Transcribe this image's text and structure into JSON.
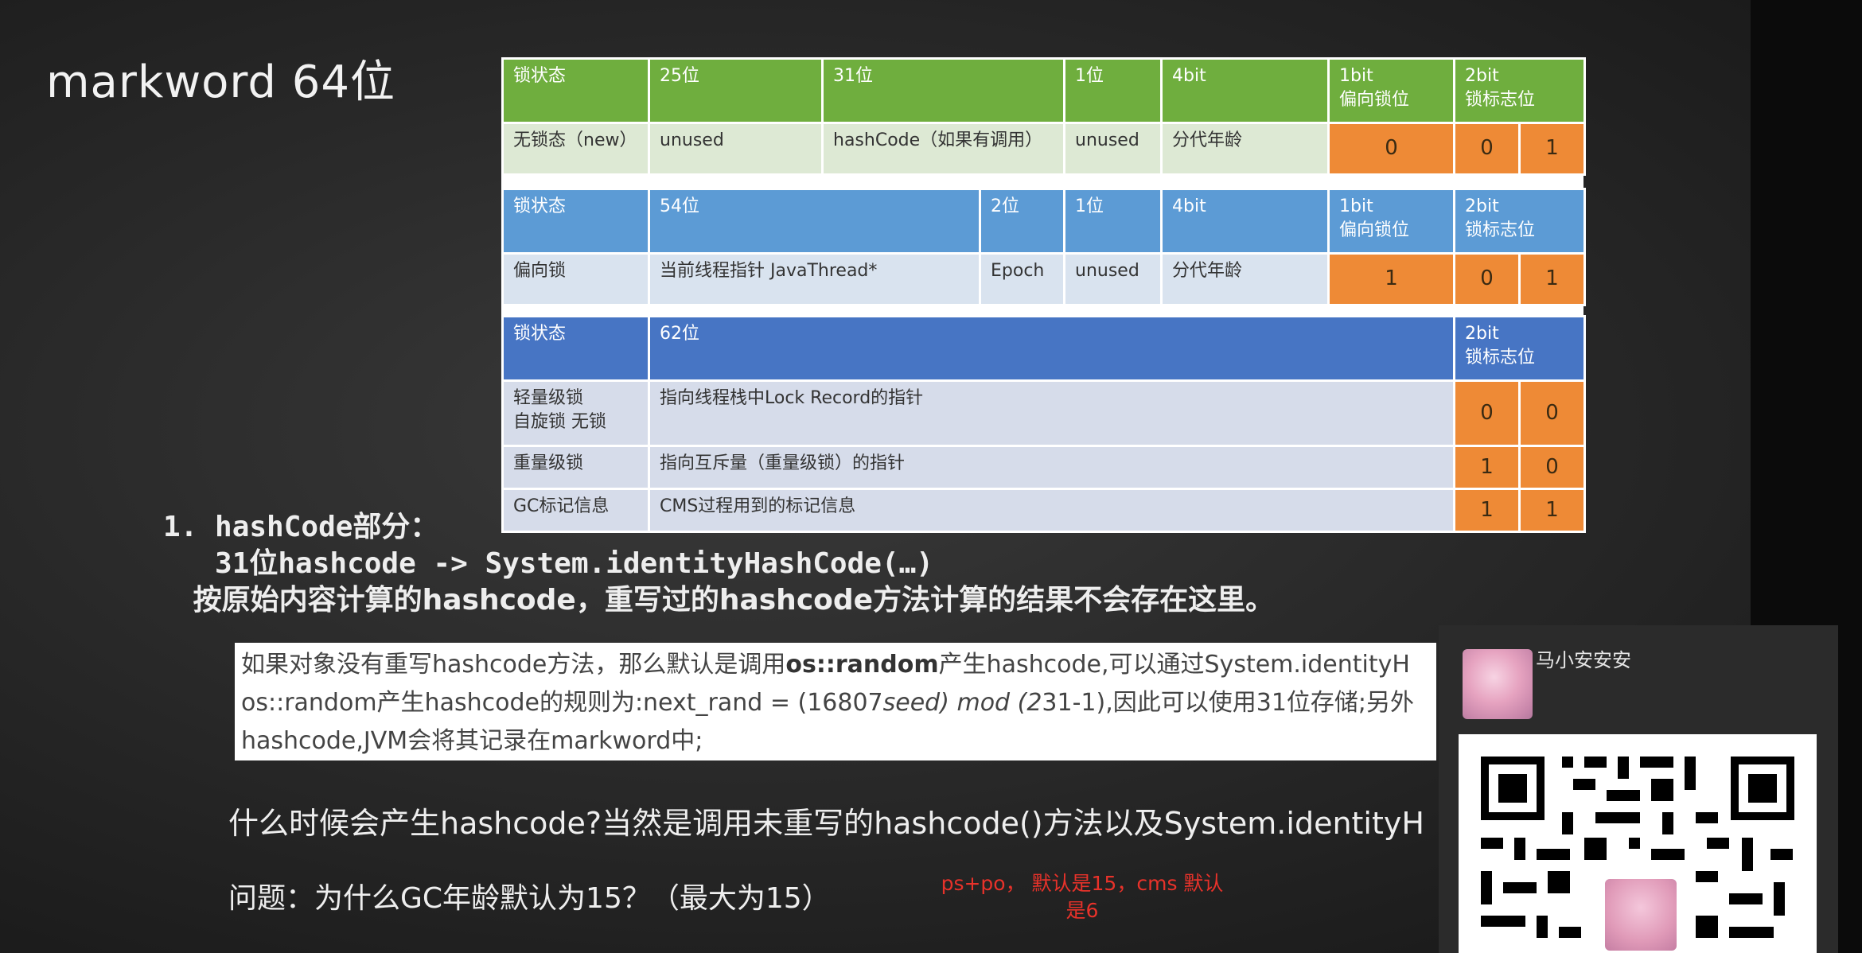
{
  "slide": {
    "title": "markword 64位"
  },
  "table": {
    "green": {
      "header": [
        "锁状态",
        "25位",
        "31位",
        "1位",
        "4bit",
        "1bit\n偏向锁位",
        "2bit\n锁标志位"
      ],
      "row": {
        "state": "无锁态（new）",
        "c25": "unused",
        "c31": "hashCode（如果有调用）",
        "c1": "unused",
        "age": "分代年龄",
        "biased": "0",
        "flag1": "0",
        "flag2": "1"
      }
    },
    "blue": {
      "header": [
        "锁状态",
        "54位",
        "2位",
        "1位",
        "4bit",
        "1bit\n偏向锁位",
        "2bit\n锁标志位"
      ],
      "row": {
        "state": "偏向锁",
        "c54": "当前线程指针 JavaThread*",
        "epoch": "Epoch",
        "c1": "unused",
        "age": "分代年龄",
        "biased": "1",
        "flag1": "0",
        "flag2": "1"
      }
    },
    "dark": {
      "header": [
        "锁状态",
        "62位",
        "2bit\n锁标志位"
      ],
      "rows": [
        {
          "state": "轻量级锁\n自旋锁 无锁",
          "content": "指向线程栈中Lock Record的指针",
          "flag1": "0",
          "flag2": "0"
        },
        {
          "state": "重量级锁",
          "content": "指向互斥量（重量级锁）的指针",
          "flag1": "1",
          "flag2": "0"
        },
        {
          "state": "GC标记信息",
          "content": "CMS过程用到的标记信息",
          "flag1": "1",
          "flag2": "1"
        }
      ]
    }
  },
  "section": {
    "line1": "1. hashCode部分：",
    "line2": "   31位hashcode -> System.identityHashCode(…)",
    "line3": "   按原始内容计算的hashcode，重写过的hashcode方法计算的结果不会存在这里。"
  },
  "note": {
    "line1_a": "如果对象没有重写hashcode方法，那么默认是调用",
    "line1_b": "os::random",
    "line1_c": "产生hashcode,可以通过System.identityH",
    "line2_a": "os::random产生hashcode的规则为:next_rand = (16807",
    "line2_b": "seed) mod (2",
    "line2_c": "31-1),因此可以使用31位存储;另外",
    "line3": "hashcode,JVM会将其记录在markword中;"
  },
  "questions": {
    "q1": "什么时候会产生hashcode?当然是调用未重写的hashcode()方法以及System.identityH",
    "q2": "问题：为什么GC年龄默认为15？（最大为15）"
  },
  "red_note": {
    "line1": "ps+po， 默认是15，cms 默认",
    "line2": "是6"
  },
  "panel": {
    "username": "马小安安安"
  },
  "colors": {
    "green": "#6fae3e",
    "blue": "#5c9bd5",
    "darkblue": "#4775c4",
    "orange": "#ee8a36",
    "red": "#e8322a"
  },
  "icons": {
    "avatar": "anime-avatar",
    "qr": "qr-code"
  }
}
